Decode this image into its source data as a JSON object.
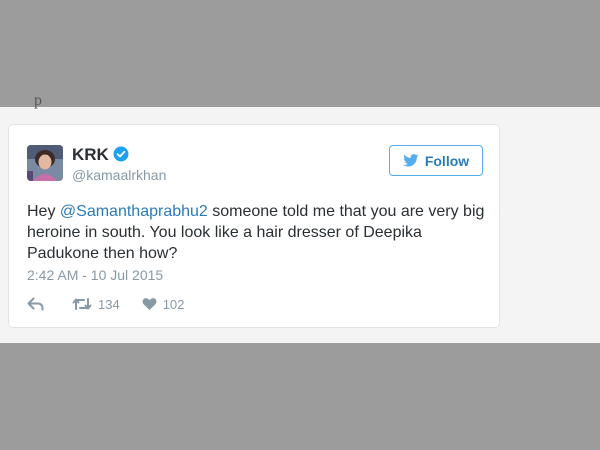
{
  "background_text": "p",
  "tweet": {
    "author_name": "KRK",
    "author_handle": "@kamaalrkhan",
    "verified": true,
    "follow_label": "Follow",
    "text_before": "Hey ",
    "mention": "@Samanthaprabhu2",
    "text_after": " someone told me that you are very big heroine in south. You look like a hair dresser of Deepika Padukone then how?",
    "timestamp": "2:42 AM - 10 Jul 2015",
    "retweet_count": "134",
    "like_count": "102"
  },
  "icons": {
    "verified": "verified-badge-icon",
    "follow": "twitter-bird-icon",
    "reply": "reply-icon",
    "retweet": "retweet-icon",
    "like": "heart-icon"
  },
  "colors": {
    "outer_background": "#9c9c9c",
    "page_band": "#f4f4f4",
    "link": "#2b7bb9",
    "verified": "#1da1f2",
    "muted": "#8899a6",
    "text": "#292f33",
    "follow_border": "#55acee"
  }
}
